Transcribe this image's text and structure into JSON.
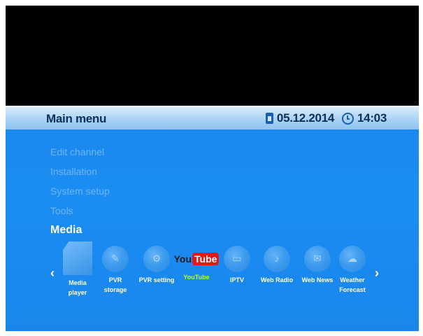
{
  "header": {
    "title": "Main menu",
    "date": "05.12.2014",
    "time": "14:03"
  },
  "menu": {
    "items": [
      {
        "label": "Edit channel",
        "active": false
      },
      {
        "label": "Installation",
        "active": false
      },
      {
        "label": "System setup",
        "active": false
      },
      {
        "label": "Tools",
        "active": false
      },
      {
        "label": "Media",
        "active": true
      }
    ]
  },
  "media_icons": {
    "left_arrow": "‹",
    "right_arrow": "›",
    "items": [
      {
        "label_line1": "Media",
        "label_line2": "player",
        "icon": "media-player-icon"
      },
      {
        "label_line1": "PVR",
        "label_line2": "storage",
        "icon": "pvr-storage-icon"
      },
      {
        "label_line1": "PVR setting",
        "label_line2": "",
        "icon": "pvr-setting-icon"
      },
      {
        "label_line1": "YouTube",
        "label_line2": "",
        "icon": "youtube-icon",
        "selected": true,
        "logo_you": "You",
        "logo_tube": "Tube"
      },
      {
        "label_line1": "IPTV",
        "label_line2": "",
        "icon": "iptv-icon"
      },
      {
        "label_line1": "Web Radio",
        "label_line2": "",
        "icon": "web-radio-icon"
      },
      {
        "label_line1": "Web News",
        "label_line2": "",
        "icon": "web-news-icon"
      },
      {
        "label_line1": "Weather",
        "label_line2": "Forecast",
        "icon": "weather-forecast-icon"
      }
    ]
  },
  "colors": {
    "background": "#1b8df3",
    "header_text": "#0c2f58",
    "menu_inactive": "#6fb6f5",
    "selected_label": "#b8ff2a"
  }
}
